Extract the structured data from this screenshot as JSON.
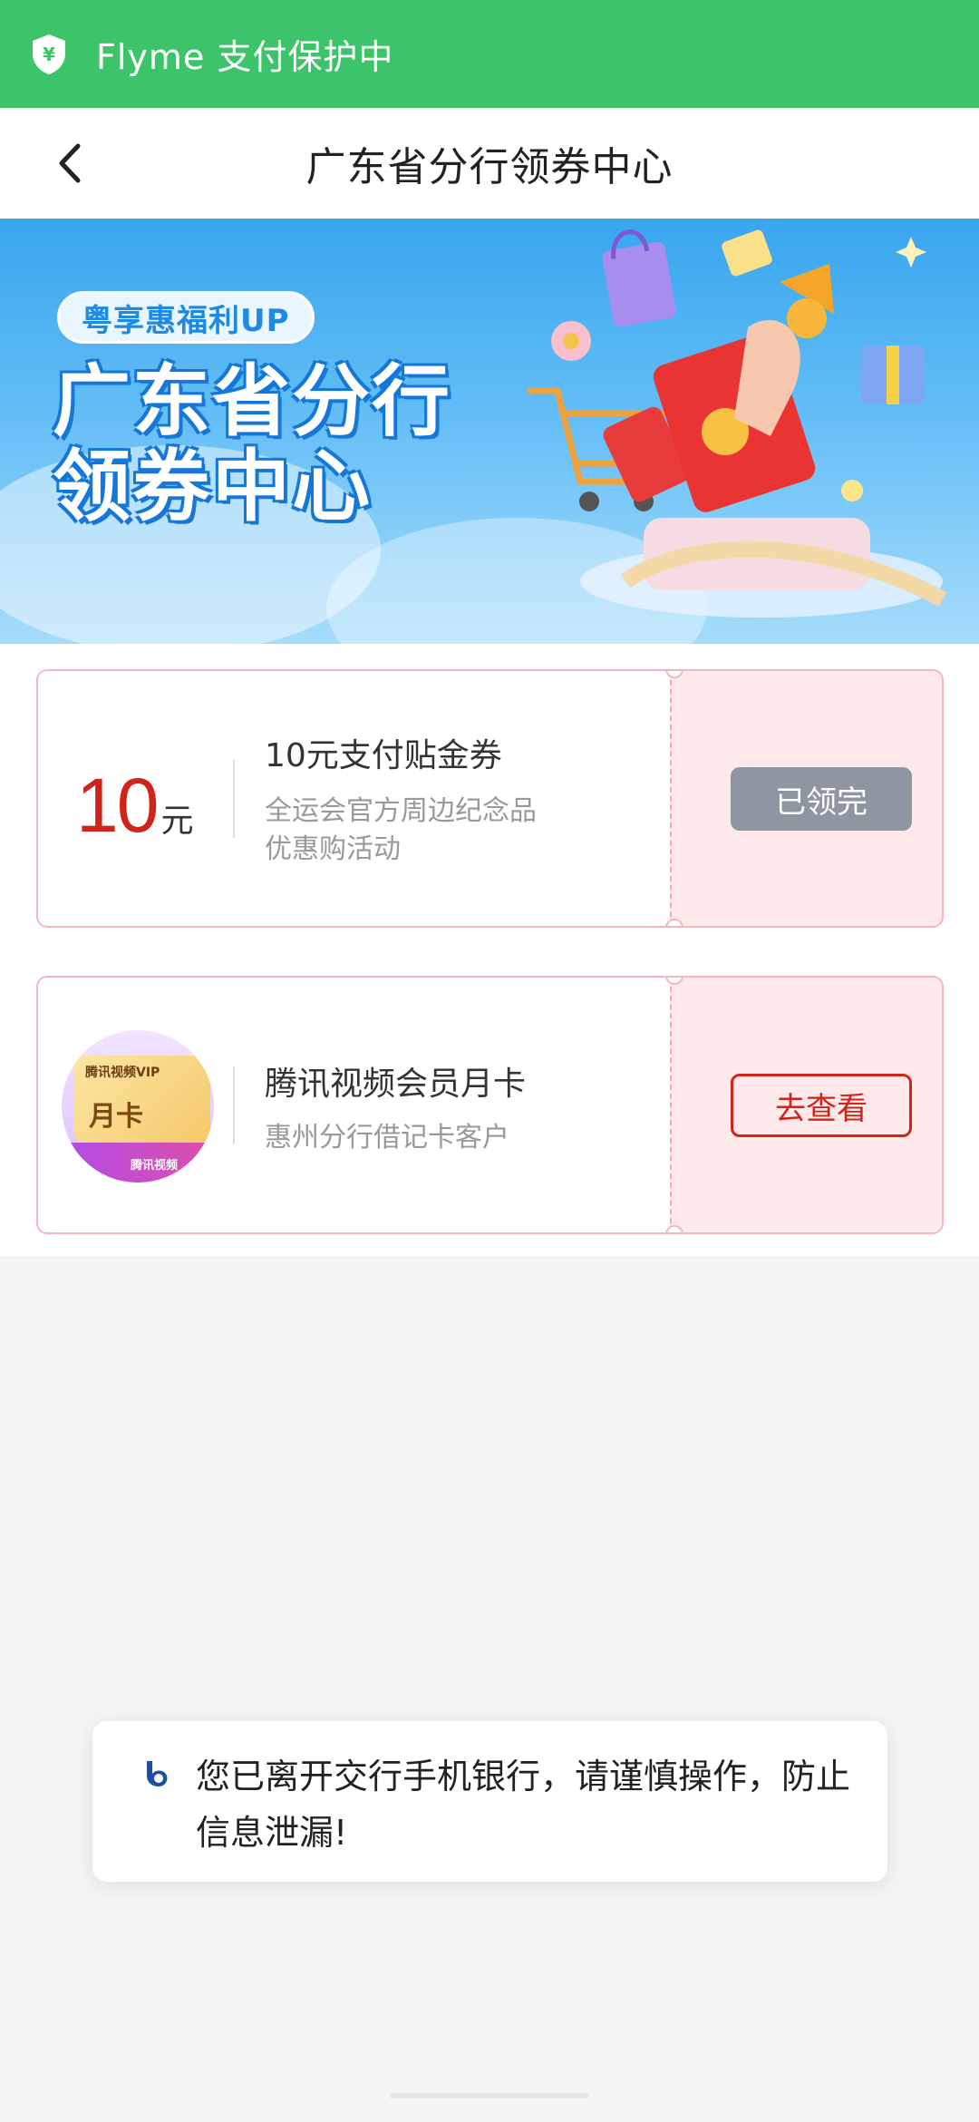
{
  "protect_bar": {
    "text": "Flyme 支付保护中",
    "icon": "shield-yuan-icon",
    "color": "#3dc46a"
  },
  "header": {
    "title": "广东省分行领券中心",
    "back_icon": "chevron-left-icon"
  },
  "banner": {
    "tag": "粤享惠福利UP",
    "title_line1": "广东省分行",
    "title_line2": "领券中心"
  },
  "coupons": [
    {
      "amount": "10",
      "unit": "元",
      "title": "10元支付贴金券",
      "desc_line1": "全运会官方周边纪念品",
      "desc_line2": "优惠购活动",
      "button": "已领完",
      "status": "claimed"
    },
    {
      "thumb_vip": "腾讯视频VIP",
      "thumb_month": "月卡",
      "thumb_bottom": "腾讯视频",
      "title": "腾讯视频会员月卡",
      "desc": "惠州分行借记卡客户",
      "button": "去查看",
      "status": "available"
    }
  ],
  "toast": {
    "text": "您已离开交行手机银行，请谨慎操作，防止信息泄漏!",
    "icon": "bank-logo-icon"
  },
  "colors": {
    "accent_red": "#d0241b",
    "banner_blue": "#39a6ee"
  }
}
